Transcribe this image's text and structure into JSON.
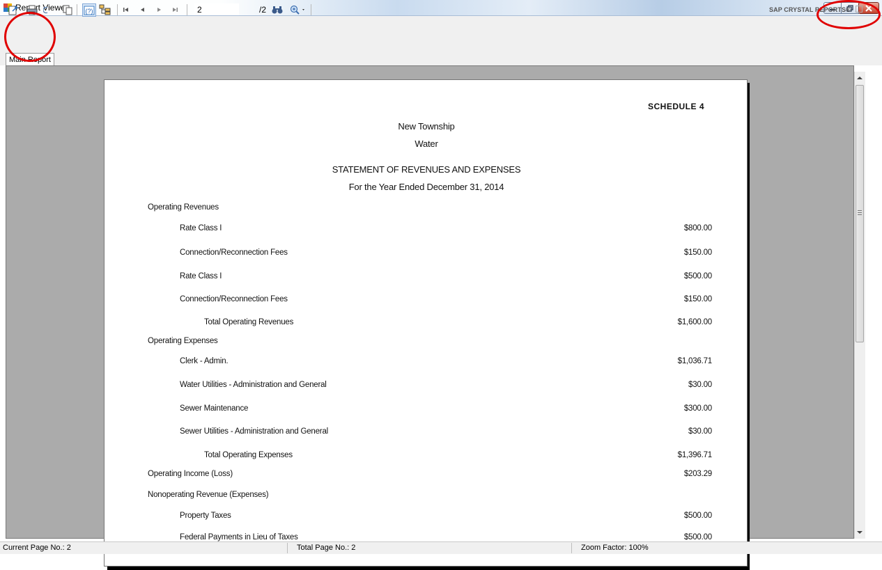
{
  "window": {
    "title": "Report Viewer"
  },
  "toolbar": {
    "page_input": "2",
    "page_total": "/2",
    "brand": "SAP CRYSTAL REPORTS®"
  },
  "tabs": {
    "main": "Main Report"
  },
  "report": {
    "schedule": "SCHEDULE 4",
    "entity": "New Township",
    "fund": "Water",
    "statement": "STATEMENT OF REVENUES AND EXPENSES",
    "period": "For the Year Ended December 31, 2014",
    "lines": [
      {
        "label": "Operating Revenues",
        "amount": ""
      },
      {
        "label": "Rate Class I",
        "amount": "$800.00"
      },
      {
        "label": "Connection/Reconnection Fees",
        "amount": "$150.00"
      },
      {
        "label": "Rate Class I",
        "amount": "$500.00"
      },
      {
        "label": "Connection/Reconnection Fees",
        "amount": "$150.00"
      },
      {
        "label": "Total Operating Revenues",
        "amount": "$1,600.00"
      },
      {
        "label": "Operating Expenses",
        "amount": ""
      },
      {
        "label": "Clerk - Admin.",
        "amount": "$1,036.71"
      },
      {
        "label": "Water Utilities - Administration and General",
        "amount": "$30.00"
      },
      {
        "label": "Sewer Maintenance",
        "amount": "$300.00"
      },
      {
        "label": "Sewer Utilities - Administration and General",
        "amount": "$30.00"
      },
      {
        "label": "Total Operating Expenses",
        "amount": "$1,396.71"
      },
      {
        "label": "Operating Income (Loss)",
        "amount": "$203.29"
      },
      {
        "label": "Nonoperating Revenue (Expenses)",
        "amount": ""
      },
      {
        "label": "Property Taxes",
        "amount": "$500.00"
      },
      {
        "label": "Federal Payments in Lieu of Taxes",
        "amount": "$500.00"
      }
    ]
  },
  "status": {
    "current_page": "Current Page No.: 2",
    "total_page": "Total Page No.: 2",
    "zoom": "Zoom Factor: 100%"
  },
  "colors": {
    "annotation": "#e00000",
    "close_button": "#c4402b"
  }
}
